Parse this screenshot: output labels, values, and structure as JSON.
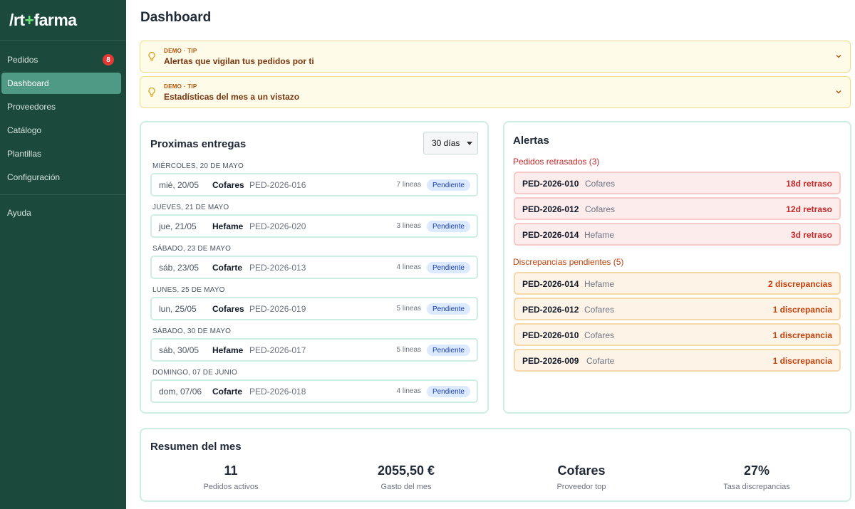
{
  "brand": {
    "prefix": "/rt",
    "plus": "+",
    "suffix": "farma"
  },
  "sidebar": {
    "items": [
      {
        "label": "Pedidos",
        "badge": "8"
      },
      {
        "label": "Dashboard"
      },
      {
        "label": "Proveedores"
      },
      {
        "label": "Catálogo"
      },
      {
        "label": "Plantillas"
      },
      {
        "label": "Configuración"
      }
    ],
    "help": "Ayuda"
  },
  "page": {
    "title": "Dashboard"
  },
  "tips": [
    {
      "tag": "DEMO · TIP",
      "text": "Alertas que vigilan tus pedidos por ti"
    },
    {
      "tag": "DEMO · TIP",
      "text": "Estadísticas del mes a un vistazo"
    }
  ],
  "entregas": {
    "title": "Proximas entregas",
    "range": "30 días",
    "groups": [
      {
        "day": "MIÉRCOLES, 20 DE MAYO",
        "date": "mié, 20/05",
        "provider": "Cofares",
        "order": "PED-2026-016",
        "lines": "7 lineas",
        "status": "Pendiente"
      },
      {
        "day": "JUEVES, 21 DE MAYO",
        "date": "jue, 21/05",
        "provider": "Hefame",
        "order": "PED-2026-020",
        "lines": "3 lineas",
        "status": "Pendiente"
      },
      {
        "day": "SÁBADO, 23 DE MAYO",
        "date": "sáb, 23/05",
        "provider": "Cofarte",
        "order": "PED-2026-013",
        "lines": "4 lineas",
        "status": "Pendiente"
      },
      {
        "day": "LUNES, 25 DE MAYO",
        "date": "lun, 25/05",
        "provider": "Cofares",
        "order": "PED-2026-019",
        "lines": "5 lineas",
        "status": "Pendiente"
      },
      {
        "day": "SÁBADO, 30 DE MAYO",
        "date": "sáb, 30/05",
        "provider": "Hefame",
        "order": "PED-2026-017",
        "lines": "5 lineas",
        "status": "Pendiente"
      },
      {
        "day": "DOMINGO, 07 DE JUNIO",
        "date": "dom, 07/06",
        "provider": "Cofarte",
        "order": "PED-2026-018",
        "lines": "4 lineas",
        "status": "Pendiente"
      }
    ]
  },
  "alertas": {
    "title": "Alertas",
    "retrasados_title": "Pedidos retrasados (3)",
    "retrasados": [
      {
        "order": "PED-2026-010",
        "provider": "Cofares",
        "value": "18d retraso"
      },
      {
        "order": "PED-2026-012",
        "provider": "Cofares",
        "value": "12d retraso"
      },
      {
        "order": "PED-2026-014",
        "provider": "Hefame",
        "value": "3d retraso"
      }
    ],
    "discrepancias_title": "Discrepancias pendientes (5)",
    "discrepancias": [
      {
        "order": "PED-2026-014",
        "provider": "Hefame",
        "value": "2 discrepancias"
      },
      {
        "order": "PED-2026-012",
        "provider": "Cofares",
        "value": "1 discrepancia"
      },
      {
        "order": "PED-2026-010",
        "provider": "Cofares",
        "value": "1 discrepancia"
      },
      {
        "order": "PED-2026-009",
        "provider": "Cofarte",
        "value": "1 discrepancia"
      }
    ]
  },
  "resumen": {
    "title": "Resumen del mes",
    "stats": [
      {
        "value": "11",
        "label": "Pedidos activos"
      },
      {
        "value": "2055,50 €",
        "label": "Gasto del mes"
      },
      {
        "value": "Cofares",
        "label": "Proveedor top"
      },
      {
        "value": "27%",
        "label": "Tasa discrepancias"
      }
    ]
  }
}
